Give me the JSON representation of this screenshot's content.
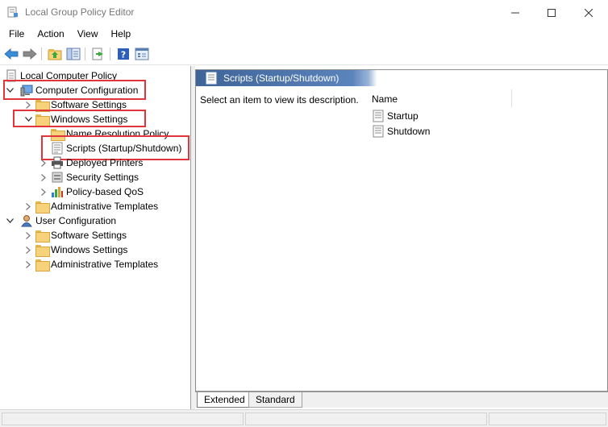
{
  "window": {
    "title": "Local Group Policy Editor",
    "controls": [
      "minimize",
      "maximize",
      "close"
    ]
  },
  "menu": [
    "File",
    "Action",
    "View",
    "Help"
  ],
  "toolbar": {
    "buttons": [
      "back-icon",
      "forward-icon",
      "up-folder-icon",
      "show-hide-tree-icon",
      "export-list-icon",
      "help-icon",
      "properties-icon"
    ]
  },
  "tree": {
    "root": "Local Computer Policy",
    "computer_config": "Computer Configuration",
    "cc_software": "Software Settings",
    "cc_windows": "Windows Settings",
    "cc_name_resolution": "Name Resolution Policy",
    "cc_scripts": "Scripts (Startup/Shutdown)",
    "cc_printers": "Deployed Printers",
    "cc_security": "Security Settings",
    "cc_qos": "Policy-based QoS",
    "cc_admin": "Administrative Templates",
    "user_config": "User Configuration",
    "uc_software": "Software Settings",
    "uc_windows": "Windows Settings",
    "uc_admin": "Administrative Templates"
  },
  "right_pane": {
    "header": "Scripts (Startup/Shutdown)",
    "description": "Select an item to view its description.",
    "column_name": "Name",
    "items": [
      "Startup",
      "Shutdown"
    ]
  },
  "tabs": [
    "Extended",
    "Standard"
  ],
  "colors": {
    "highlight_border": "#e0353b",
    "header_blue": "#3e6498"
  }
}
